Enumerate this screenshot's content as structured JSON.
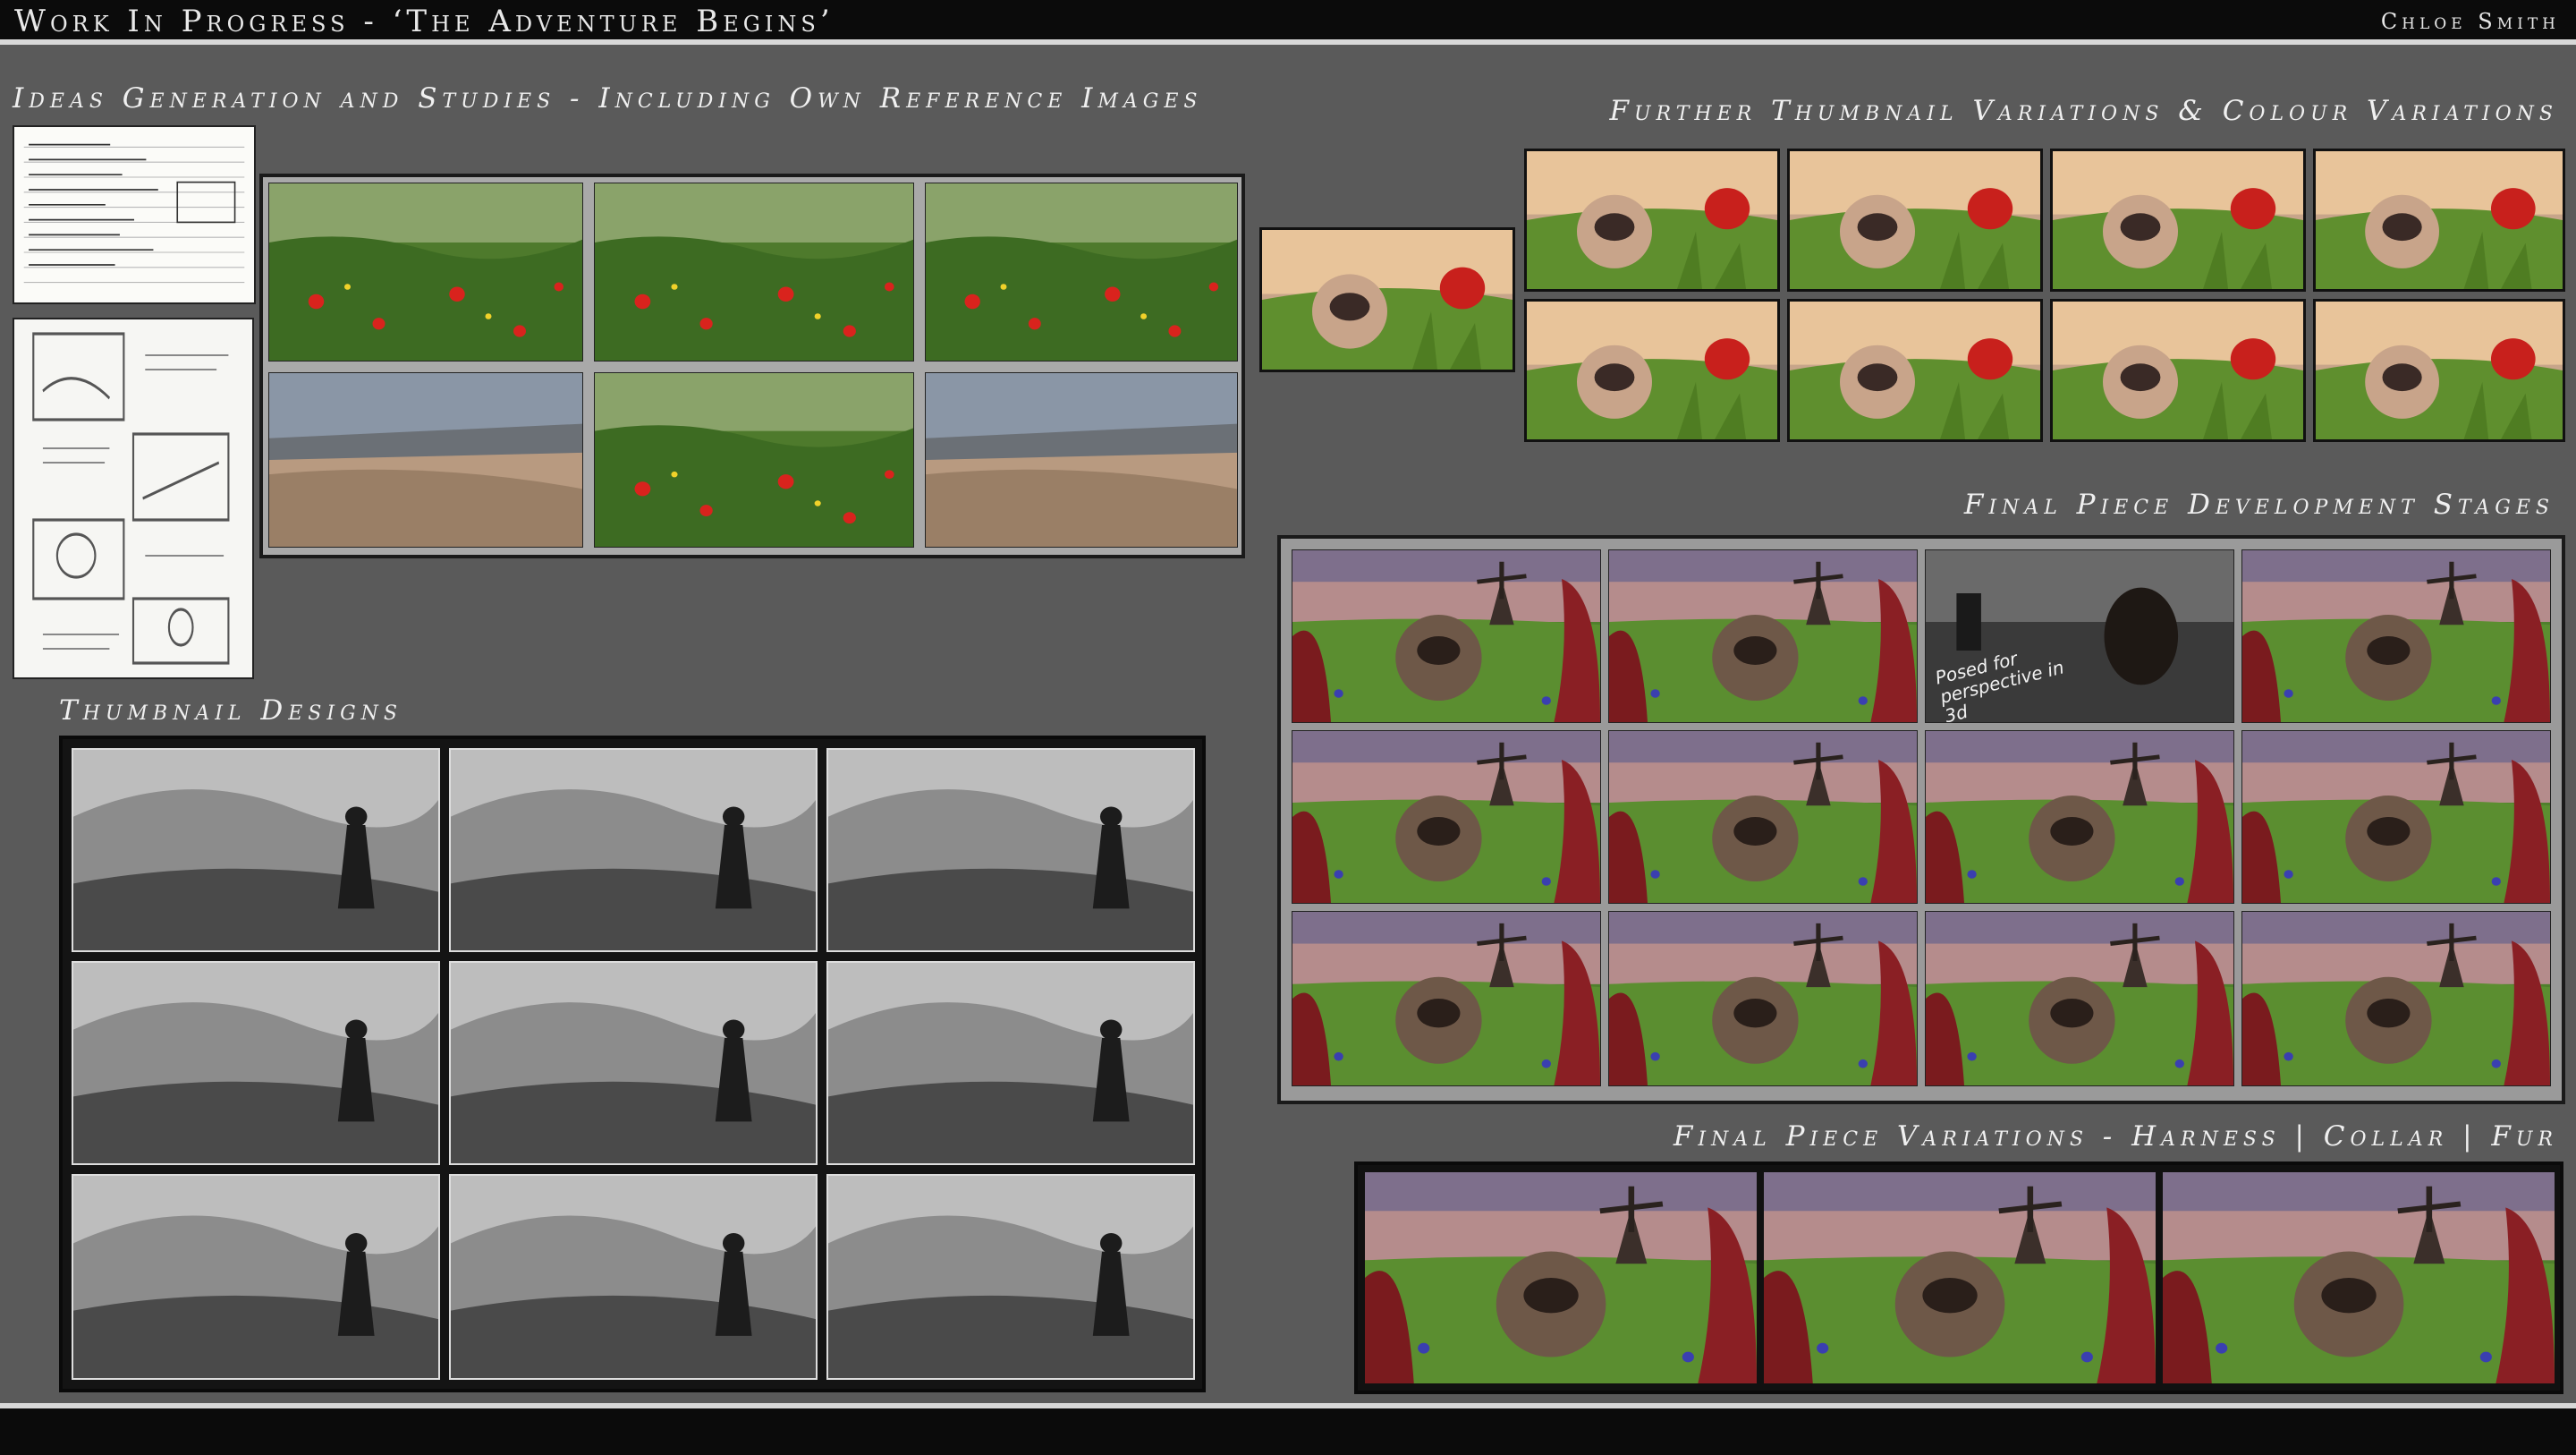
{
  "header": {
    "title": "Work In Progress - ‘The Adventure Begins’",
    "author": "Chloe Smith"
  },
  "sections": {
    "ideas": "Ideas Generation and Studies - Including Own Reference Images",
    "further_thumbnails": "Further Thumbnail Variations & Colour Variations",
    "thumbnail_designs": "Thumbnail Designs",
    "final_development": "Final Piece Development Stages",
    "final_variations": "Final Piece Variations - Harness | Collar | Fur"
  },
  "annotations": {
    "posed_note": "Posed for perspective in 3d"
  },
  "colors": {
    "background": "#5a5a5a",
    "bar": "#0b0b0b",
    "accent_line": "#d8d8d8"
  }
}
